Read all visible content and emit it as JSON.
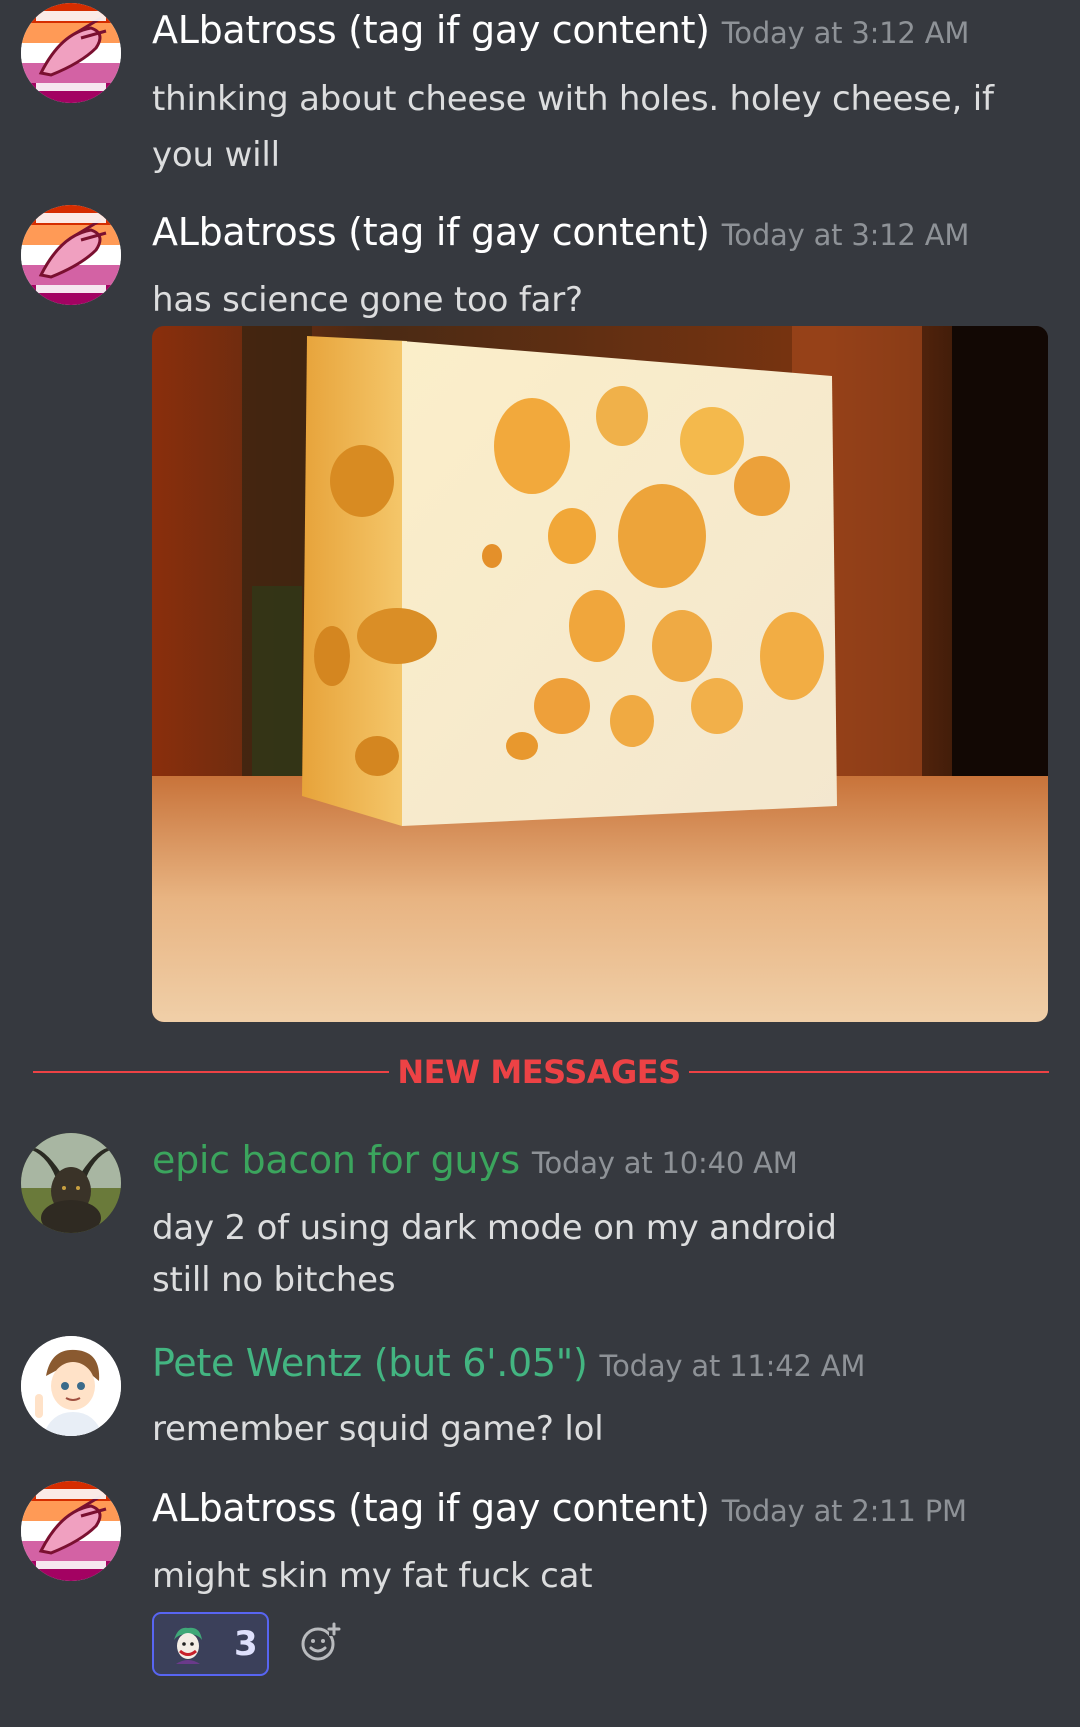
{
  "messages": [
    {
      "author": "ALbatross (tag if gay content)",
      "timestamp": "Today at 3:12 AM",
      "text": "thinking about cheese with holes. holey cheese, if you will"
    },
    {
      "author": "ALbatross (tag if gay content)",
      "timestamp": "Today at 3:12 AM",
      "text": "has science gone too far?"
    },
    {
      "author": "epic bacon for guys",
      "timestamp": "Today at 10:40 AM",
      "text_line1": "day 2 of using dark mode on my android",
      "text_line2": "still no bitches"
    },
    {
      "author": "Pete Wentz (but 6'.05\")",
      "timestamp": "Today at 11:42 AM",
      "text": "remember squid game? lol"
    },
    {
      "author": "ALbatross (tag if gay content)",
      "timestamp": "Today at 2:11 PM",
      "text": "might skin my fat fuck cat"
    }
  ],
  "divider_label": "NEW MESSAGES",
  "reaction": {
    "emoji": "joker-emoji",
    "count": "3"
  },
  "icons": {
    "add_reaction": "add-reaction-icon"
  },
  "colors": {
    "background": "#36393f",
    "new_messages_red": "#ed4245",
    "username_green": "#3ba55d",
    "reaction_border": "#5865f2"
  }
}
